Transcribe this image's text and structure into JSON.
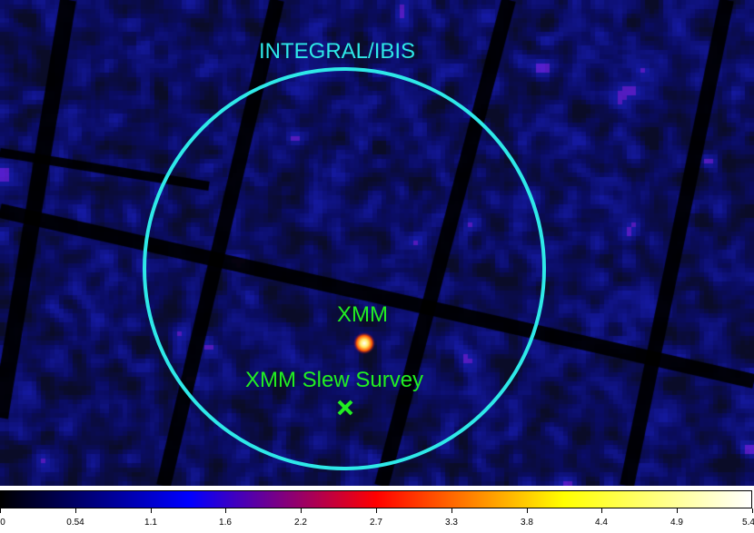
{
  "image": {
    "labels": {
      "instrument": "INTEGRAL/IBIS",
      "xmm": "XMM",
      "slew": "XMM Slew Survey"
    },
    "colors": {
      "circle": "#2ee8e8",
      "instrument_label": "#2ee8e8",
      "source_label": "#22ee22",
      "marker": "#22ee22",
      "background": "#0e1166",
      "chip_gap": "#000000"
    },
    "marker_icon": "cross-marker-icon"
  },
  "colorbar": {
    "tick_labels": [
      "0",
      "0.54",
      "1.1",
      "1.6",
      "2.2",
      "2.7",
      "3.3",
      "3.8",
      "4.4",
      "4.9",
      "5.4"
    ],
    "gradient": [
      "#000000",
      "#0000ff",
      "#ff0000",
      "#ffff00",
      "#ffffff"
    ]
  }
}
